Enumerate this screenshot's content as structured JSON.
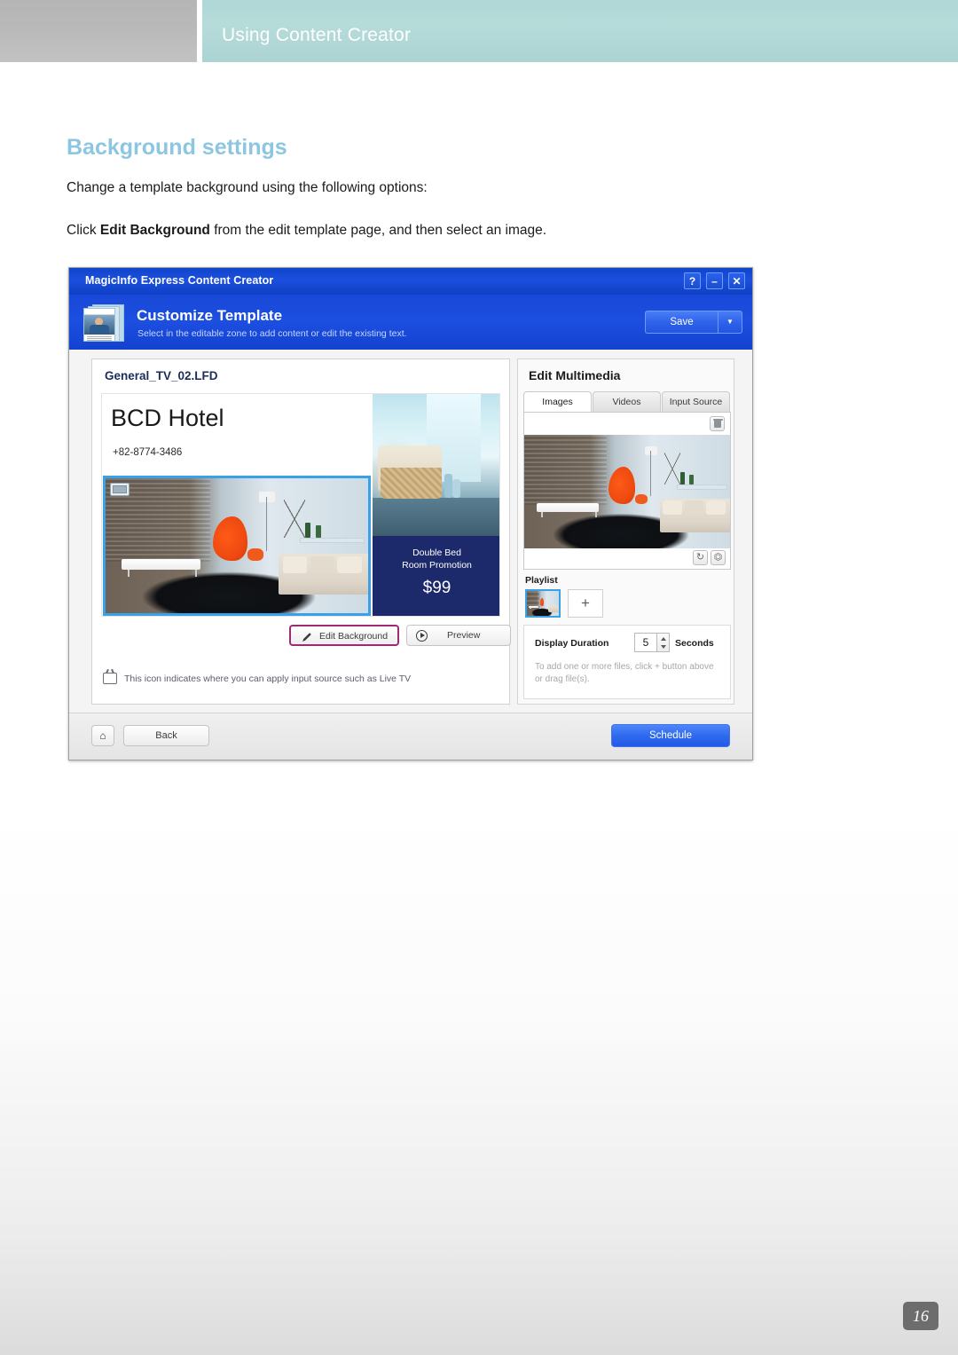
{
  "page": {
    "header_title": "Using Content Creator",
    "number": "16"
  },
  "document": {
    "heading": "Background settings",
    "paragraph_1": "Change a template background using the following options:",
    "paragraph_2_pre": "Click ",
    "paragraph_2_bold": "Edit Background",
    "paragraph_2_post": " from the edit template page, and then select an image."
  },
  "app": {
    "titlebar": {
      "title": "MagicInfo Express Content Creator",
      "help_label": "?",
      "minimize_label": "–",
      "close_label": "✕"
    },
    "header": {
      "title": "Customize Template",
      "subtitle": "Select in the editable zone to add content or edit the existing text.",
      "save_label": "Save",
      "save_dropdown_label": "▼"
    },
    "left_panel": {
      "template_name": "General_TV_02.LFD",
      "template": {
        "hotel_name": "BCD Hotel",
        "phone": "+82-8774-3486",
        "promo_line_1": "Double Bed",
        "promo_line_2": "Room Promotion",
        "promo_price": "$99"
      },
      "edit_background_label": "Edit Background",
      "preview_label": "Preview",
      "input_source_note": "This icon indicates where you can apply input source such as Live TV"
    },
    "right_panel": {
      "title": "Edit Multimedia",
      "tabs": [
        {
          "label": "Images",
          "active": true
        },
        {
          "label": "Videos",
          "active": false
        },
        {
          "label": "Input Source",
          "active": false
        }
      ],
      "playlist_label": "Playlist",
      "playlist_add_label": "+",
      "duration_label": "Display Duration",
      "duration_value": "5",
      "duration_unit": "Seconds",
      "duration_hint": "To add one or more files, click + button above or drag file(s)."
    },
    "footer": {
      "home_label": "⌂",
      "back_label": "Back",
      "schedule_label": "Schedule"
    }
  },
  "colors": {
    "header_band": "#b0d6d5",
    "heading": "#8dc6e0",
    "app_blue": "#1b4ed9",
    "accent_magenta": "#9c2b73",
    "selection_blue": "#3aa0e8",
    "promo_navy": "#1c2a6b"
  }
}
